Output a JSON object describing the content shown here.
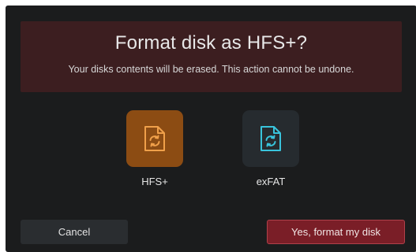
{
  "dialog": {
    "title": "Format disk as HFS+?",
    "subtitle": "Your disks contents will be erased. This action cannot be undone."
  },
  "formats": [
    {
      "label": "HFS+",
      "icon": "file-sync-icon",
      "selected": true,
      "accent": "#f0a04a"
    },
    {
      "label": "exFAT",
      "icon": "file-sync-icon",
      "selected": false,
      "accent": "#39c4dc"
    }
  ],
  "buttons": {
    "cancel": "Cancel",
    "confirm": "Yes, format my disk"
  },
  "colors": {
    "background": "#1b1c1d",
    "warning_banner": "#3c1e20",
    "selected_tile": "#8c4c13",
    "unselected_tile": "#262b2f",
    "confirm_button": "#7a1e27"
  }
}
